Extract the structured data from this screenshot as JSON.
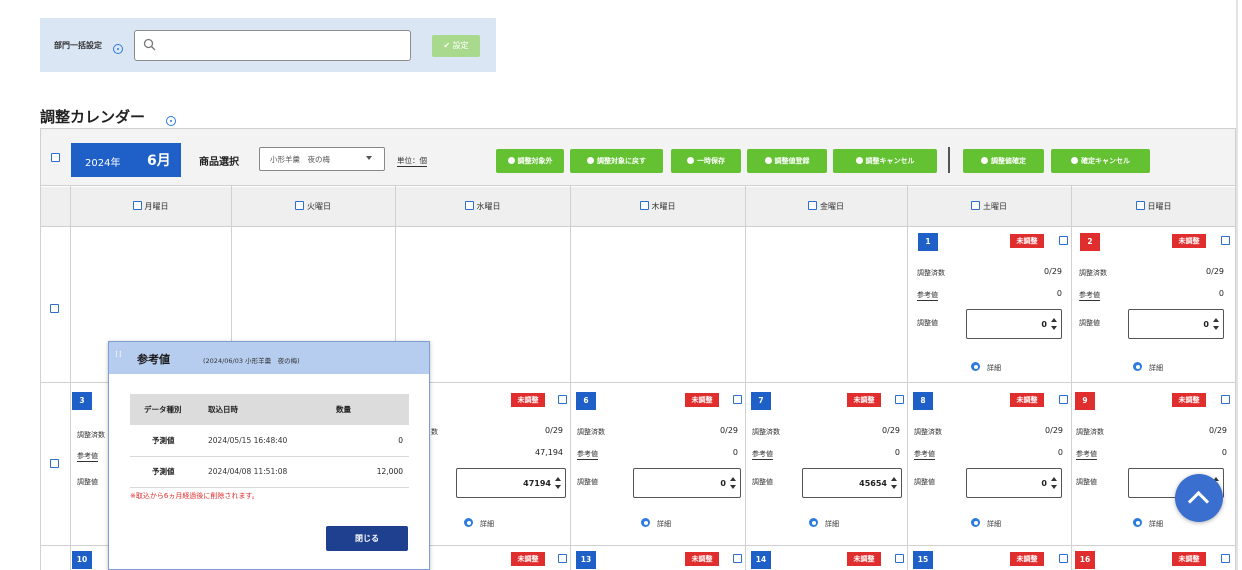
{
  "dept": {
    "label": "部門一括設定",
    "search_placeholder": "",
    "set_button": "✔ 設定"
  },
  "title": "調整カレンダー",
  "toolbar": {
    "year": "2024年",
    "month": "6月",
    "product_label": "商品選択",
    "product_value": "小形羊羹　夜の梅",
    "unit": "単位：個",
    "buttons": [
      "調整対象外",
      "調整対象に戻す",
      "一時保存",
      "調整値登録",
      "調整キャンセル",
      "調整値確定",
      "確定キャンセル"
    ]
  },
  "weekdays": [
    "月曜日",
    "火曜日",
    "水曜日",
    "木曜日",
    "金曜日",
    "土曜日",
    "日曜日"
  ],
  "cell_labels": {
    "status": "未調整",
    "count_label": "調整済数",
    "ref_label": "参考値",
    "adj_label": "調整値",
    "detail": "詳細"
  },
  "row1": [
    {
      "day": "1",
      "count": "0/29",
      "ref": "0",
      "adj": "0"
    },
    {
      "day": "2",
      "count": "0/29",
      "ref": "0",
      "adj": "0"
    }
  ],
  "row2": [
    {
      "day": "3"
    },
    {
      "count": "0/29",
      "ref": "47,194",
      "adj": "47194"
    },
    {
      "day": "6",
      "count": "0/29",
      "ref": "0",
      "adj": "0"
    },
    {
      "day": "7",
      "count": "0/29",
      "ref": "0",
      "adj": "45654"
    },
    {
      "day": "8",
      "count": "0/29",
      "ref": "0",
      "adj": "0"
    },
    {
      "day": "9",
      "count": "0/29",
      "ref": "0",
      "adj": ""
    }
  ],
  "row3": [
    "10",
    "13",
    "14",
    "15",
    "16"
  ],
  "row2_partial_label": "数",
  "popup": {
    "title": "参考値",
    "subtitle": "(2024/06/03 小形羊羹　夜の梅)",
    "headers": [
      "データ種別",
      "取込日時",
      "数量"
    ],
    "rows": [
      {
        "type": "予測値",
        "date": "2024/05/15 16:48:40",
        "qty": "0"
      },
      {
        "type": "予測値",
        "date": "2024/04/08 11:51:08",
        "qty": "12,000"
      }
    ],
    "note": "※取込から6ヵ月経過後に削除されます。",
    "close": "閉じる"
  },
  "colors": {
    "blue": "#1f5fc8",
    "green": "#63c132",
    "red": "#e02d2d",
    "panel": "#dbe6f5"
  }
}
